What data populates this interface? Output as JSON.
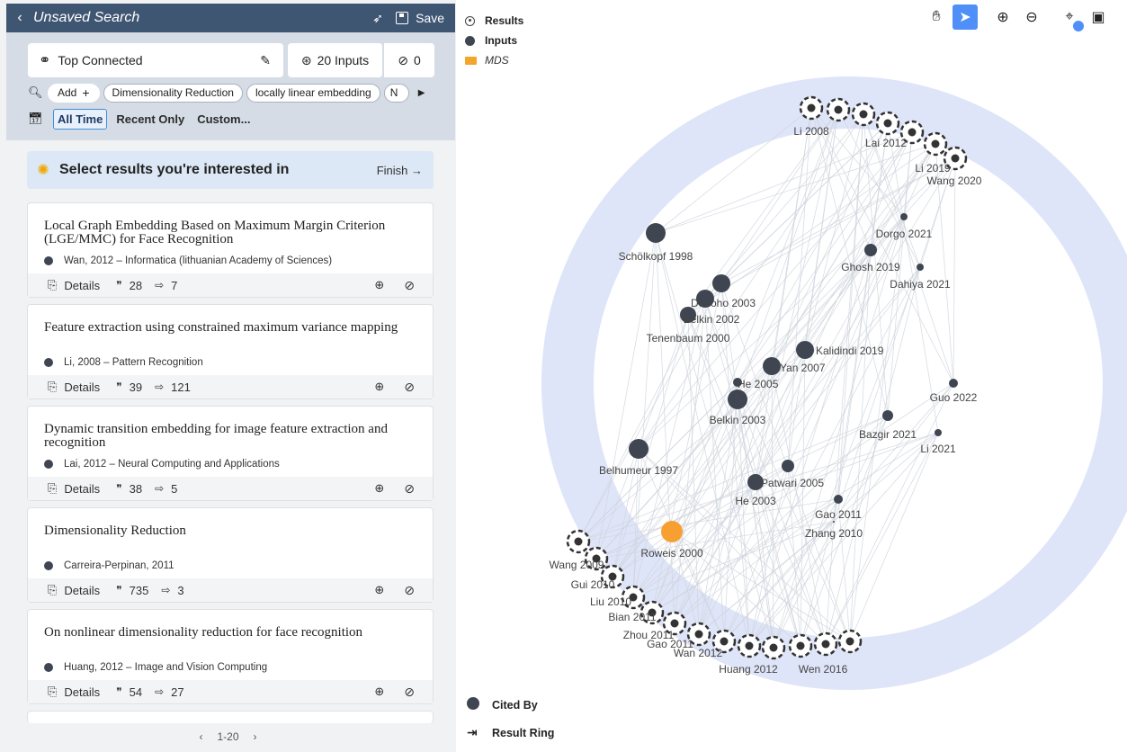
{
  "left": {
    "title": "Unsaved Search",
    "save_label": "Save",
    "algorithm_label": "Top Connected",
    "inputs_label": "20 Inputs",
    "excluded_count": "0",
    "chips": [
      "Add",
      "Dimensionality Reduction",
      "locally linear embedding",
      "N"
    ],
    "time_filters": [
      "All Time",
      "Recent Only",
      "Custom..."
    ],
    "hint_text": "Select results you're interested in",
    "finish_label": "Finish →",
    "details_label": "Details",
    "cards": [
      {
        "title": "Local Graph Embedding Based on Maximum Margin Criterion (LGE/MMC) for Face Recognition",
        "meta": "Wan, 2012 – Informatica (lithuanian Academy of Sciences)",
        "cites": "28",
        "refs": "7"
      },
      {
        "title": "Feature extraction using constrained maximum variance mapping",
        "meta": "Li, 2008 – Pattern Recognition",
        "cites": "39",
        "refs": "121"
      },
      {
        "title": "Dynamic transition embedding for image feature extraction and recognition",
        "meta": "Lai, 2012 – Neural Computing and Applications",
        "cites": "38",
        "refs": "5"
      },
      {
        "title": "Dimensionality Reduction",
        "meta": "Carreira-Perpinan, 2011",
        "cites": "735",
        "refs": "3"
      },
      {
        "title": "On nonlinear dimensionality reduction for face recognition",
        "meta": "Huang, 2012 – Image and Vision Computing",
        "cites": "54",
        "refs": "27"
      }
    ],
    "pager": {
      "range": "1-20",
      "prev": "‹",
      "next": "›"
    }
  },
  "right": {
    "legend": {
      "results": "Results",
      "inputs": "Inputs",
      "group": "MDS"
    },
    "bottom_legend": {
      "cited_by": "Cited By",
      "result_ring": "Result Ring"
    },
    "tools": [
      "hand-icon",
      "pointer-icon",
      "zoom-in-icon",
      "zoom-out-icon",
      "locate-icon",
      "image-icon"
    ],
    "colors": {
      "input": "#3f4652",
      "highlight": "#f7a031",
      "ring": "#dfe5f8",
      "edge": "#cfd4dd"
    },
    "graph": {
      "inputs": [
        {
          "id": "scholkopf",
          "label": "Schölkopf 1998"
        },
        {
          "id": "donoho",
          "label": "Donoho 2003"
        },
        {
          "id": "belkin2002",
          "label": "Belkin 2002"
        },
        {
          "id": "tenenbaum",
          "label": "Tenenbaum 2000"
        },
        {
          "id": "dorgo",
          "label": "Dorgo 2021"
        },
        {
          "id": "ghosh",
          "label": "Ghosh 2019"
        },
        {
          "id": "dahiya",
          "label": "Dahiya 2021"
        },
        {
          "id": "kalidindi",
          "label": "Kalidindi 2019"
        },
        {
          "id": "yan",
          "label": "Yan 2007"
        },
        {
          "id": "he2005",
          "label": "He 2005"
        },
        {
          "id": "guo",
          "label": "Guo 2022"
        },
        {
          "id": "belkin2003",
          "label": "Belkin 2003"
        },
        {
          "id": "bazgir",
          "label": "Bazgir 2021"
        },
        {
          "id": "li2021",
          "label": "Li 2021"
        },
        {
          "id": "belhumeur",
          "label": "Belhumeur 1997"
        },
        {
          "id": "patwari",
          "label": "Patwari 2005"
        },
        {
          "id": "he2003",
          "label": "He 2003"
        },
        {
          "id": "gao2011a",
          "label": "Gao 2011"
        },
        {
          "id": "zhang",
          "label": "Zhang 2010"
        },
        {
          "id": "roweis",
          "label": "Roweis 2000",
          "highlight": true
        }
      ],
      "results": [
        "Li 2008",
        "Lai 2012",
        "Li 2019",
        "Wang 2020",
        "Wang 2009",
        "Gui 2010",
        "Liu 2010",
        "Bian 2011",
        "Zhou 2011",
        "Gao 2011",
        "Wan 2012",
        "Huang 2012",
        "Wen 2016"
      ]
    }
  }
}
